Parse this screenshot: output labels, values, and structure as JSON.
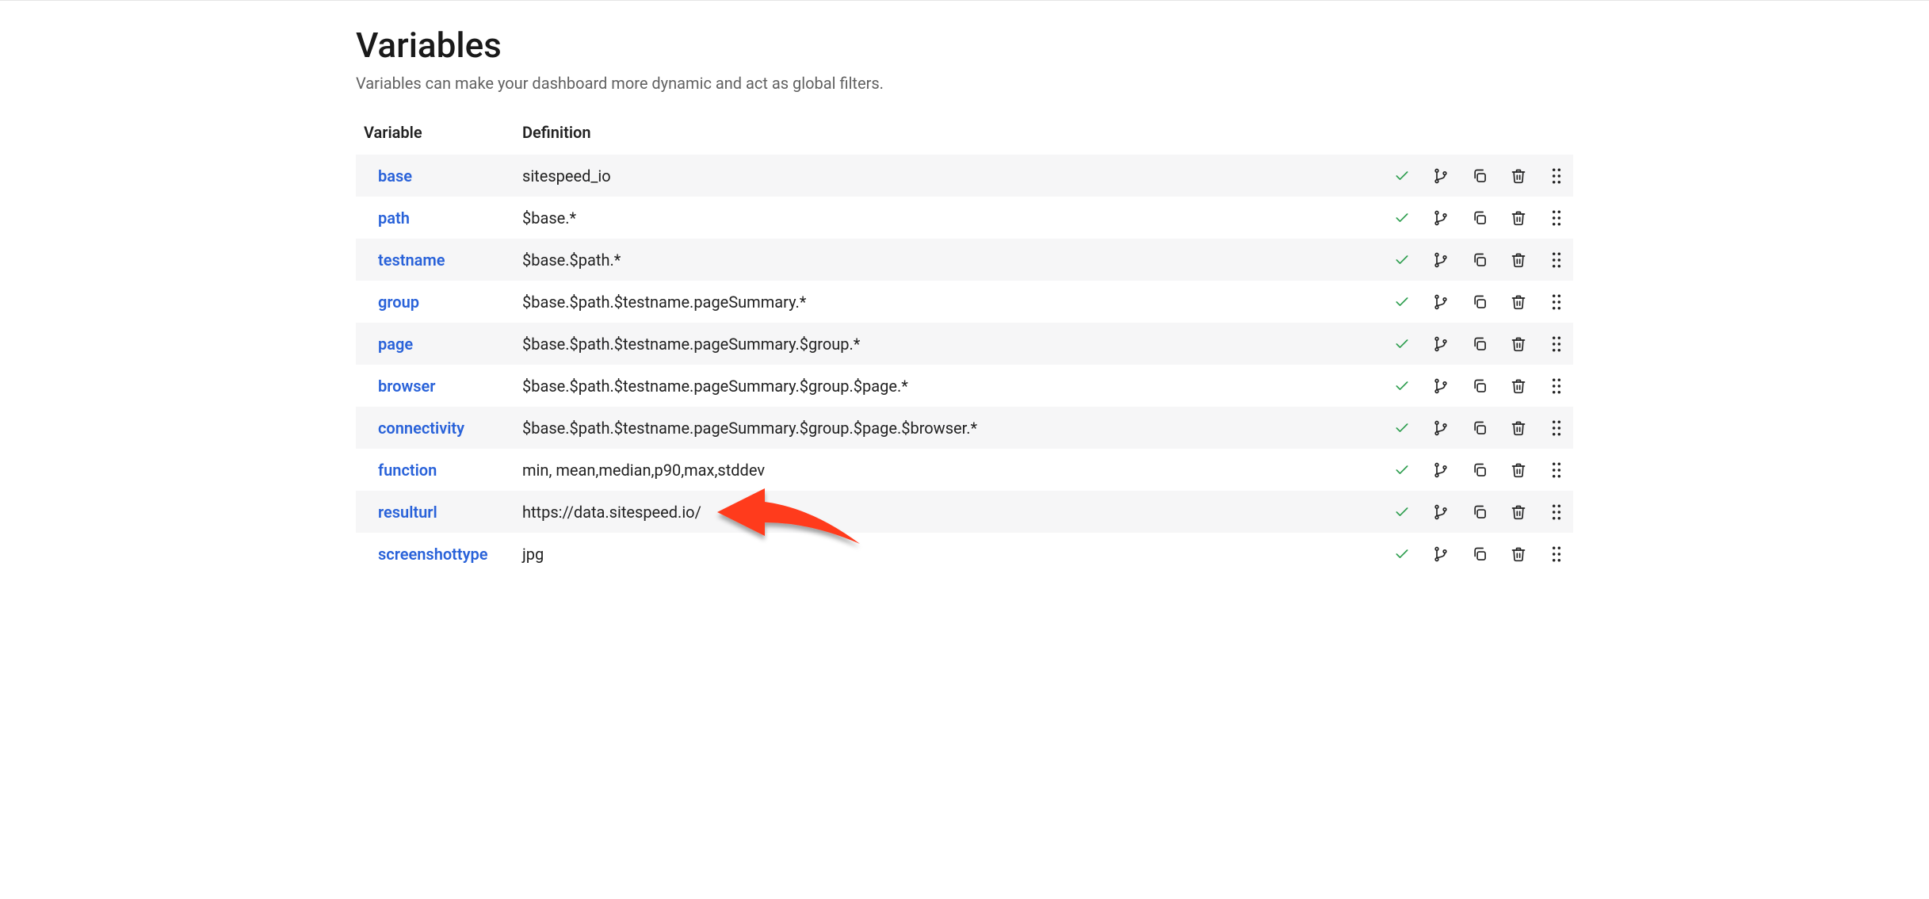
{
  "header": {
    "title": "Variables",
    "subtitle": "Variables can make your dashboard more dynamic and act as global filters."
  },
  "columns": {
    "variable": "Variable",
    "definition": "Definition"
  },
  "rows": [
    {
      "name": "base",
      "definition": "sitespeed_io"
    },
    {
      "name": "path",
      "definition": "$base.*"
    },
    {
      "name": "testname",
      "definition": "$base.$path.*"
    },
    {
      "name": "group",
      "definition": "$base.$path.$testname.pageSummary.*"
    },
    {
      "name": "page",
      "definition": "$base.$path.$testname.pageSummary.$group.*"
    },
    {
      "name": "browser",
      "definition": "$base.$path.$testname.pageSummary.$group.$page.*"
    },
    {
      "name": "connectivity",
      "definition": "$base.$path.$testname.pageSummary.$group.$page.$browser.*"
    },
    {
      "name": "function",
      "definition": "min, mean,median,p90,max,stddev"
    },
    {
      "name": "resulturl",
      "definition": "https://data.sitespeed.io/"
    },
    {
      "name": "screenshottype",
      "definition": "jpg"
    }
  ],
  "annotation": {
    "target_row_index": 8,
    "color": "#ff3b1f"
  }
}
